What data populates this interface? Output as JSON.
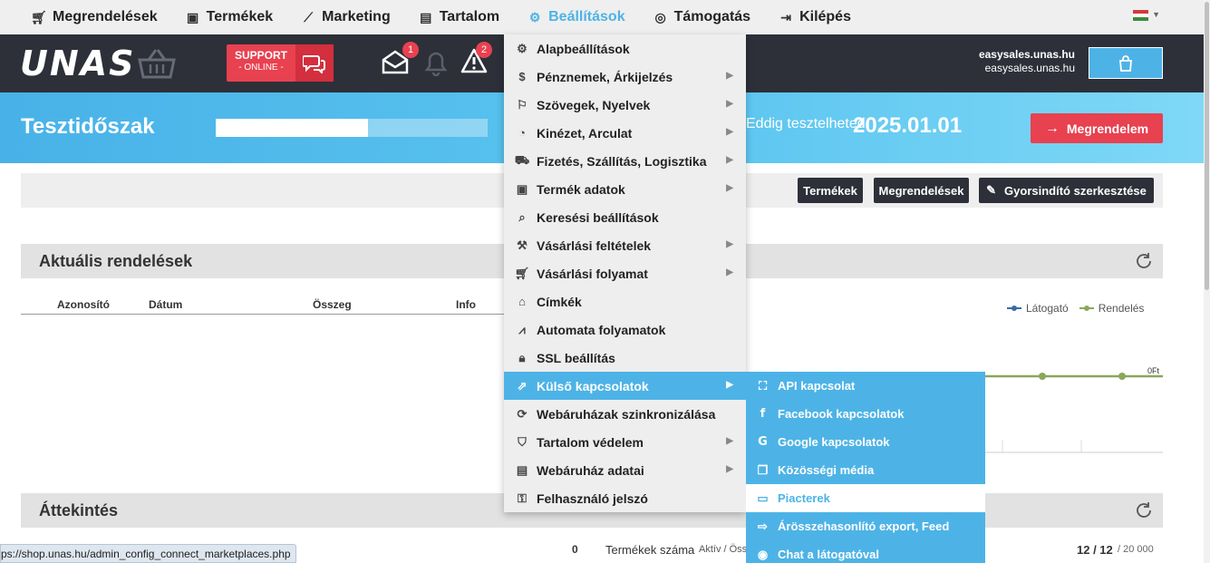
{
  "topnav": {
    "items": [
      {
        "label": "Megrendelések",
        "icon": "cart-icon"
      },
      {
        "label": "Termékek",
        "icon": "box-icon"
      },
      {
        "label": "Marketing",
        "icon": "chart-line-icon"
      },
      {
        "label": "Tartalom",
        "icon": "document-icon"
      },
      {
        "label": "Beállítások",
        "icon": "gear-icon",
        "active": true
      },
      {
        "label": "Támogatás",
        "icon": "lifebuoy-icon"
      },
      {
        "label": "Kilépés",
        "icon": "logout-icon"
      }
    ],
    "language": "hungarian-flag-icon"
  },
  "header": {
    "logo": "UNAS",
    "support": {
      "title": "SUPPORT",
      "status": "- ONLINE -"
    },
    "messages_badge": "1",
    "alerts_badge": "2",
    "account_line1": "easysales.unas.hu",
    "account_line2": "easysales.unas.hu"
  },
  "trial": {
    "title": "Tesztidőszak",
    "progress": 0.56,
    "until_label": "Eddig tesztelheted:",
    "date": "2025.01.01",
    "order_button": "Megrendelem"
  },
  "shortcuts": {
    "products": "Termékek",
    "orders": "Megrendelések",
    "edit": "Gyorsindító szerkesztése"
  },
  "orders_panel": {
    "title": "Aktuális rendelések",
    "columns": [
      "Azonosító",
      "Dátum",
      "Összeg",
      "Info"
    ]
  },
  "chart": {
    "legend": [
      "Látogató",
      "Rendelés"
    ],
    "y_tick": "0Ft",
    "colors": {
      "visitor": "#3b6aa8",
      "order": "#8aa85a"
    }
  },
  "overview_panel": {
    "title": "Áttekintés",
    "left_value": "0",
    "products_label": "Termékek száma",
    "products_sub": "Aktív / Össz",
    "products_value": "12 / 12",
    "products_limit": "/ 20 000"
  },
  "settings_menu": {
    "items": [
      {
        "label": "Alapbeállítások",
        "icon": "gears-icon",
        "sub": false
      },
      {
        "label": "Pénznemek, Árkijelzés",
        "icon": "dollar-icon",
        "sub": true
      },
      {
        "label": "Szövegek, Nyelvek",
        "icon": "flag-outline-icon",
        "sub": true
      },
      {
        "label": "Kinézet, Arculat",
        "icon": "palette-icon",
        "sub": true
      },
      {
        "label": "Fizetés, Szállítás, Logisztika",
        "icon": "truck-icon",
        "sub": true
      },
      {
        "label": "Termék adatok",
        "icon": "box-icon",
        "sub": true
      },
      {
        "label": "Keresési beállítások",
        "icon": "search-icon",
        "sub": false
      },
      {
        "label": "Vásárlási feltételek",
        "icon": "gavel-icon",
        "sub": true
      },
      {
        "label": "Vásárlási folyamat",
        "icon": "cart-icon",
        "sub": true
      },
      {
        "label": "Címkék",
        "icon": "tag-icon",
        "sub": false
      },
      {
        "label": "Automata folyamatok",
        "icon": "chart-area-icon",
        "sub": false
      },
      {
        "label": "SSL beállítás",
        "icon": "lock-icon",
        "sub": false
      },
      {
        "label": "Külső kapcsolatok",
        "icon": "external-link-icon",
        "sub": true,
        "highlighted": true
      },
      {
        "label": "Webáruházak szinkronizálása",
        "icon": "sync-icon",
        "sub": false
      },
      {
        "label": "Tartalom védelem",
        "icon": "shield-icon",
        "sub": true
      },
      {
        "label": "Webáruház adatai",
        "icon": "file-icon",
        "sub": true
      },
      {
        "label": "Felhasználó jelszó",
        "icon": "key-icon",
        "sub": false
      }
    ]
  },
  "external_submenu": {
    "items": [
      {
        "label": "API kapcsolat",
        "icon": "sitemap-icon"
      },
      {
        "label": "Facebook kapcsolatok",
        "icon": "facebook-icon"
      },
      {
        "label": "Google kapcsolatok",
        "icon": "google-icon"
      },
      {
        "label": "Közösségi média",
        "icon": "comments-icon"
      },
      {
        "label": "Piacterek",
        "icon": "store-icon",
        "selected": true
      },
      {
        "label": "Árösszehasonlító export, Feed",
        "icon": "export-icon"
      },
      {
        "label": "Chat a látogatóval",
        "icon": "user-circle-icon"
      }
    ]
  },
  "status_url": "ps://shop.unas.hu/admin_config_connect_marketplaces.php"
}
